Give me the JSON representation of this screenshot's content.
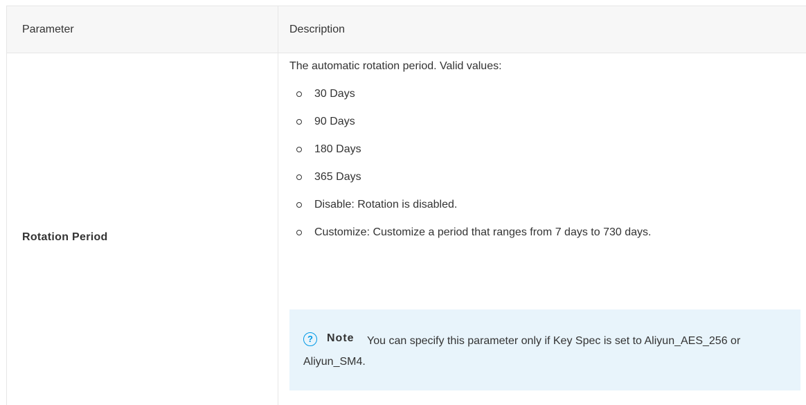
{
  "table": {
    "headers": {
      "parameter": "Parameter",
      "description": "Description"
    },
    "row": {
      "parameter": "Rotation Period",
      "intro": "The automatic rotation period. Valid values:",
      "options": [
        "30 Days",
        "90 Days",
        "180 Days",
        "365 Days",
        "Disable: Rotation is disabled.",
        "Customize: Customize a period that ranges from 7 days to 730 days."
      ],
      "note": {
        "icon": "question-circle-icon",
        "icon_glyph": "?",
        "label": "Note",
        "text": "You can specify this parameter only if Key Spec is set to Aliyun_AES_256 or Aliyun_SM4."
      }
    }
  },
  "colors": {
    "header_bg": "#f7f7f7",
    "border": "#e6e6e6",
    "note_bg": "#e8f4fb",
    "note_icon": "#0099e6",
    "text": "#333333"
  }
}
